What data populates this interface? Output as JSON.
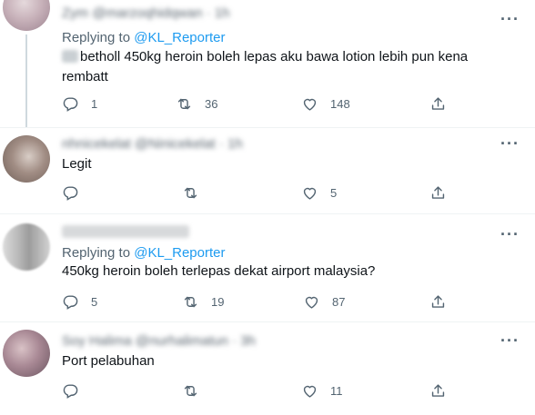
{
  "tweets": [
    {
      "header_text": "Zym @marzoqhidqwan · 1h",
      "replying_prefix": "Replying to",
      "replying_mention": "@KL_Reporter",
      "body_prefix": "",
      "body": "betholl 450kg heroin boleh lepas aku bawa lotion lebih pun kena rembatt",
      "reply_count": "1",
      "retweet_count": "36",
      "like_count": "148"
    },
    {
      "header_text": "nhnicekelat @Ninicekelat · 1h",
      "body": "Legit",
      "reply_count": "",
      "retweet_count": "",
      "like_count": "5"
    },
    {
      "header_text": "",
      "replying_prefix": "Replying to",
      "replying_mention": "@KL_Reporter",
      "body": "450kg heroin boleh terlepas dekat airport malaysia?",
      "reply_count": "5",
      "retweet_count": "19",
      "like_count": "87"
    },
    {
      "header_text": "Soy Halima @nurhalimatun · 3h",
      "body": "Port pelabuhan",
      "reply_count": "",
      "retweet_count": "",
      "like_count": "11"
    }
  ],
  "icons": {
    "more": "more-icon",
    "reply": "reply-icon",
    "retweet": "retweet-icon",
    "like": "like-icon",
    "share": "share-icon"
  },
  "colors": {
    "accent": "#1d9bf0",
    "secondary_text": "#536471",
    "primary_text": "#0f1419",
    "divider": "#eff3f4"
  }
}
